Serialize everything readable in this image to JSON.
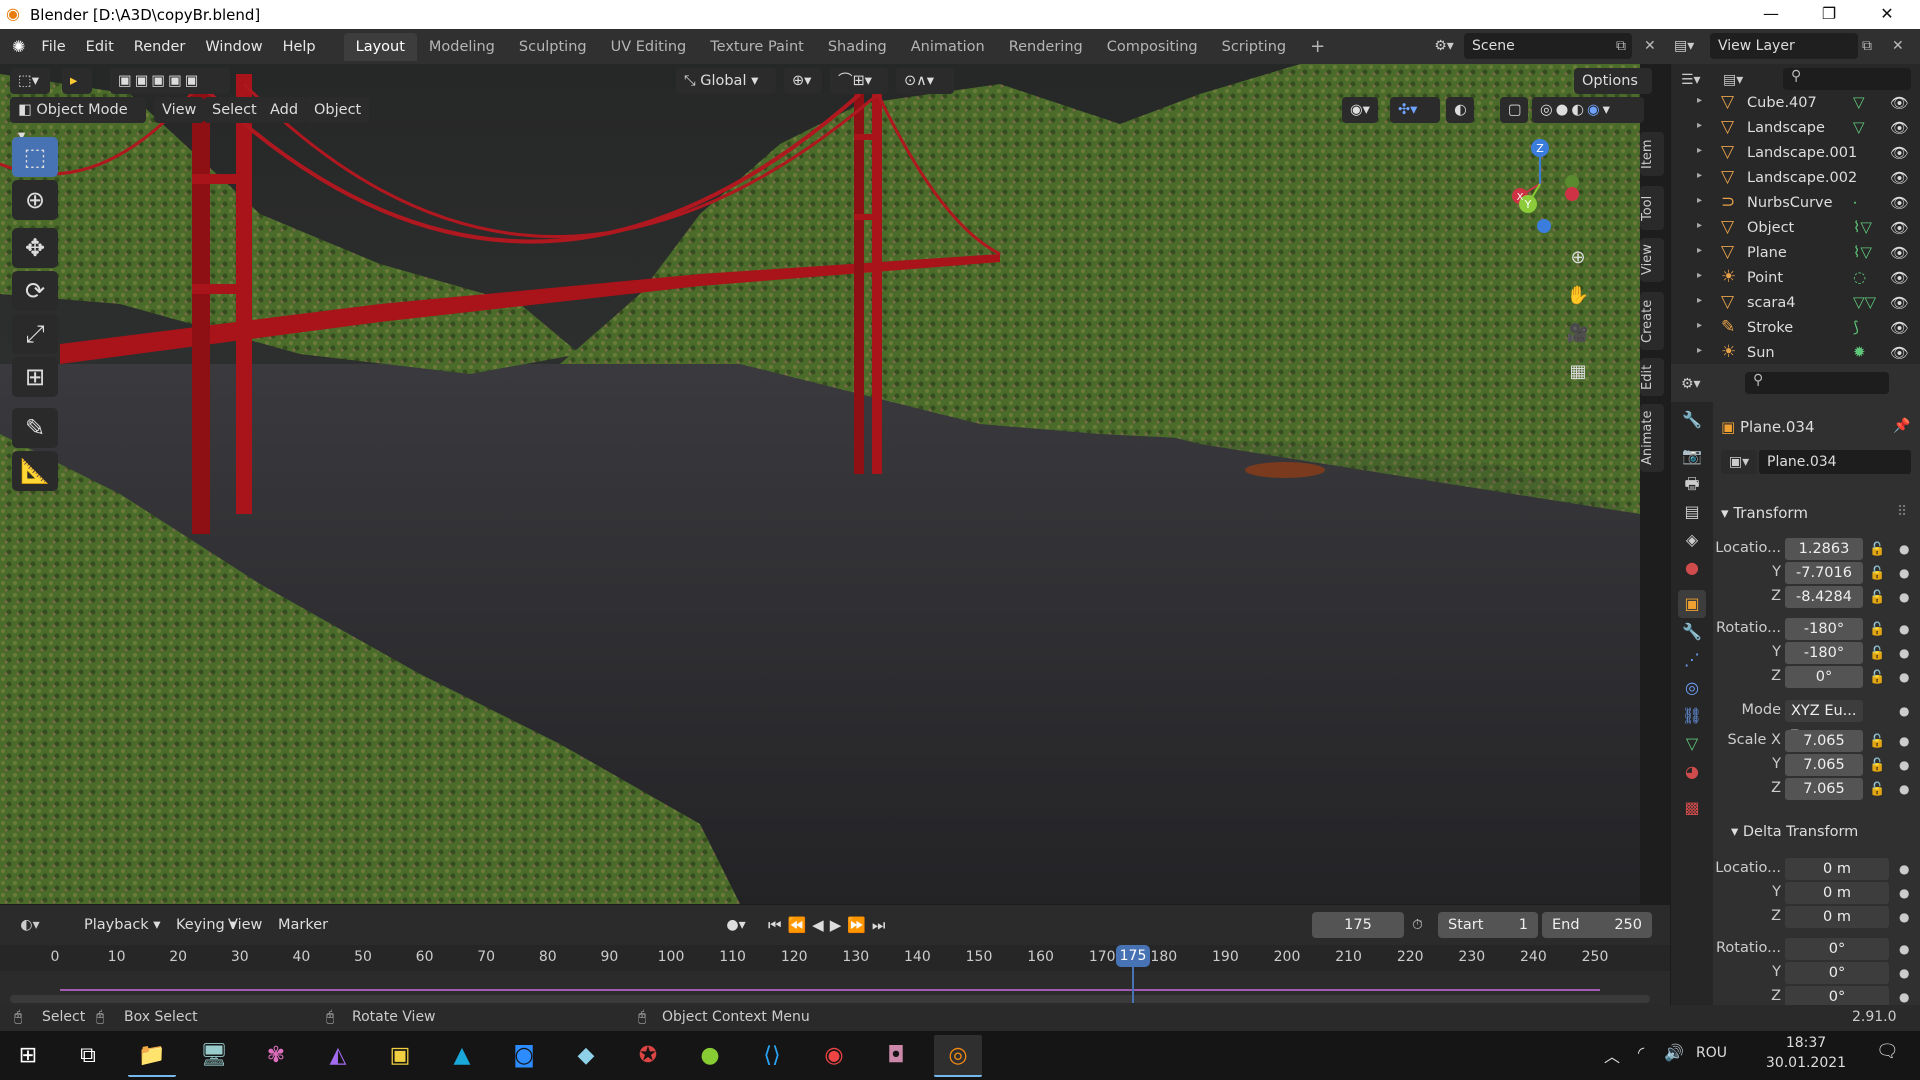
{
  "window": {
    "title": "Blender [D:\\A3D\\copyBr.blend]",
    "controls": [
      "minimize-icon",
      "restore-icon",
      "close-icon"
    ]
  },
  "menu": [
    "File",
    "Edit",
    "Render",
    "Window",
    "Help"
  ],
  "workspaces": {
    "tabs": [
      "Layout",
      "Modeling",
      "Sculpting",
      "UV Editing",
      "Texture Paint",
      "Shading",
      "Animation",
      "Rendering",
      "Compositing",
      "Scripting"
    ],
    "active": "Layout"
  },
  "scene": {
    "name": "Scene"
  },
  "view_layer": {
    "name": "View Layer"
  },
  "viewport_header": {
    "transform_orientation": "Global",
    "options": "Options",
    "mode": "Object Mode",
    "menus": [
      "View",
      "Select",
      "Add",
      "Object"
    ]
  },
  "n_panel_tabs": [
    "Item",
    "Tool",
    "View",
    "Create",
    "Edit",
    "Animate"
  ],
  "gizmo": {
    "x": "X",
    "y": "Y",
    "z": "Z"
  },
  "outliner": {
    "items": [
      {
        "name": "Cube.407",
        "icon": "mesh-icon",
        "extra": "mesh-data-icon"
      },
      {
        "name": "Landscape",
        "icon": "mesh-icon",
        "extra": "mesh-data-icon"
      },
      {
        "name": "Landscape.001",
        "icon": "mesh-icon",
        "extra": ""
      },
      {
        "name": "Landscape.002",
        "icon": "mesh-icon",
        "extra": ""
      },
      {
        "name": "NurbsCurve",
        "icon": "curve-icon",
        "extra": "curve-data-icon"
      },
      {
        "name": "Object",
        "icon": "mesh-icon",
        "extra": "modifier-mesh-icon"
      },
      {
        "name": "Plane",
        "icon": "mesh-icon",
        "extra": "modifier-mesh-icon"
      },
      {
        "name": "Point",
        "icon": "light-icon",
        "extra": "light-data-icon"
      },
      {
        "name": "scara4",
        "icon": "mesh-icon",
        "extra": "mesh-material-icon"
      },
      {
        "name": "Stroke",
        "icon": "grease-pencil-icon",
        "extra": "stroke-data-icon"
      },
      {
        "name": "Sun",
        "icon": "light-icon",
        "extra": "sun-icon"
      }
    ]
  },
  "properties": {
    "object_name": "Plane.034",
    "data_name": "Plane.034",
    "transform": {
      "header": "Transform",
      "location_label": "Locatio...",
      "location": [
        "1.2863",
        "-7.7016",
        "-8.4284"
      ],
      "rotation_label": "Rotatio...",
      "rotation": [
        "-180°",
        "-180°",
        "0°"
      ],
      "mode_label": "Mode",
      "mode": "XYZ Eu...",
      "scale_label": "Scale X",
      "scale": [
        "7.065",
        "7.065",
        "7.065"
      ],
      "axis_y": "Y",
      "axis_z": "Z"
    },
    "delta": {
      "header": "Delta Transform",
      "location_label": "Locatio...",
      "location": [
        "0 m",
        "0 m",
        "0 m"
      ],
      "rotation_label": "Rotatio...",
      "rotation": [
        "0°",
        "0°",
        "0°"
      ]
    }
  },
  "timeline": {
    "menus": [
      "Playback",
      "Keying",
      "View",
      "Marker"
    ],
    "current_frame": "175",
    "start_label": "Start",
    "start": "1",
    "end_label": "End",
    "end": "250",
    "ruler": [
      "0",
      "10",
      "20",
      "30",
      "40",
      "50",
      "60",
      "70",
      "80",
      "90",
      "100",
      "110",
      "120",
      "130",
      "140",
      "150",
      "160",
      "170",
      "180",
      "190",
      "200",
      "210",
      "220",
      "230",
      "240",
      "250"
    ],
    "playhead_label": "175"
  },
  "status": {
    "select": "Select",
    "box_select": "Box Select",
    "rotate_view": "Rotate View",
    "context_menu": "Object Context Menu",
    "version": "2.91.0"
  },
  "taskbar": {
    "apps": [
      "windows-start-icon",
      "task-view-icon",
      "file-explorer-icon",
      "computer-icon",
      "paint-icon",
      "visual-studio-icon",
      "jetbrains-icon",
      "autodesk-icon",
      "zoom-icon",
      "notes-icon",
      "game-icon",
      "lime-icon",
      "vscode-icon",
      "chrome-icon",
      "remote-icon",
      "blender-icon"
    ],
    "language": "ROU",
    "time": "18:37",
    "date": "30.01.2021"
  },
  "colors": {
    "accent": "#4772b3",
    "bridge": "#a8141a",
    "grass": "#4a6b2a",
    "water": "#2d2d30",
    "mesh_icon": "#e8a24a",
    "data_icon": "#5fc77a"
  }
}
